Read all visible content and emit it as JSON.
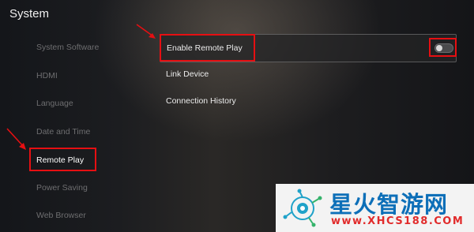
{
  "header": {
    "title": "System"
  },
  "sidebar": {
    "items": [
      {
        "label": "System Software"
      },
      {
        "label": "HDMI"
      },
      {
        "label": "Language"
      },
      {
        "label": "Date and Time"
      },
      {
        "label": "Remote Play",
        "selected": true
      },
      {
        "label": "Power Saving"
      },
      {
        "label": "Web Browser"
      }
    ]
  },
  "main": {
    "items": [
      {
        "label": "Enable Remote Play",
        "toggle": "off"
      },
      {
        "label": "Link Device"
      },
      {
        "label": "Connection History"
      }
    ]
  },
  "annotations": {
    "highlight_color": "#e60f12"
  },
  "watermark": {
    "brand": "星火智游网",
    "url": "www.XHCS188.COM"
  }
}
